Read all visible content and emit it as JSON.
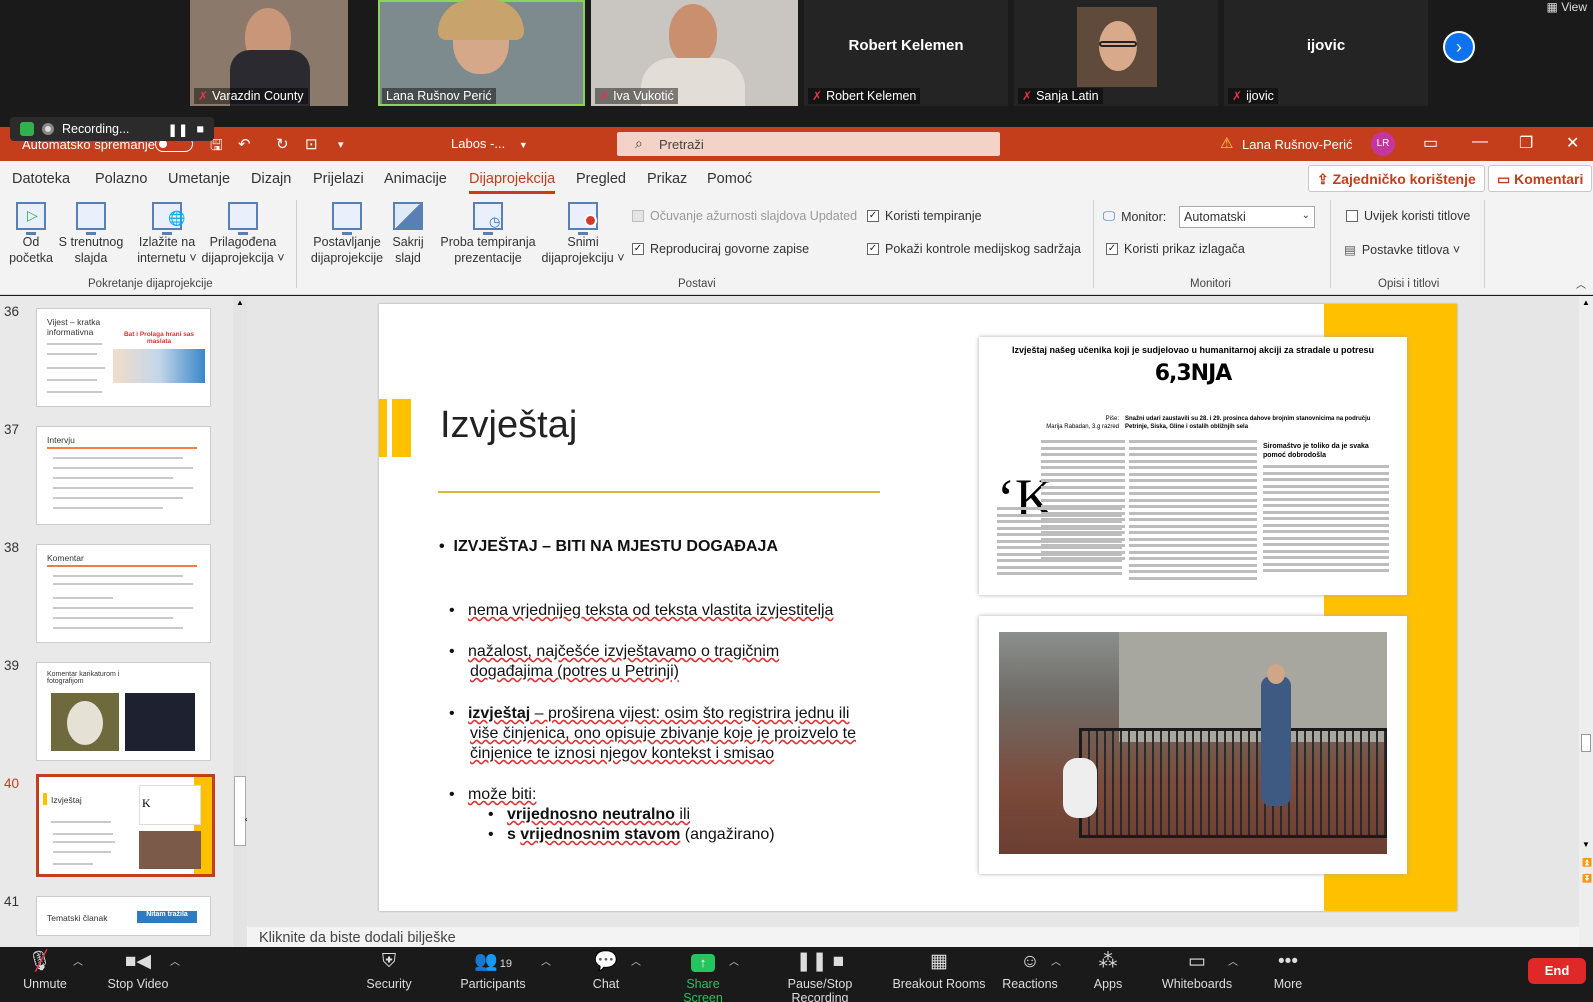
{
  "zoom": {
    "participants": [
      {
        "name": "Varazdin County",
        "muted": true
      },
      {
        "name": "Lana Rušnov Perić",
        "muted": false
      },
      {
        "name": "Iva Vukotić",
        "muted": true
      },
      {
        "name": "Robert Kelemen",
        "muted": true,
        "display_name": "Robert Kelemen"
      },
      {
        "name": "Sanja Latin",
        "muted": true
      },
      {
        "name": "ijovic",
        "muted": true,
        "display_name": "ijovic"
      }
    ],
    "view_label": "View",
    "recording_label": "Recording...",
    "toolbar": {
      "unmute": "Unmute",
      "stop_video": "Stop Video",
      "security": "Security",
      "participants": "Participants",
      "participants_count": "19",
      "chat": "Chat",
      "share_screen": "Share Screen",
      "pause_recording": "Pause/Stop Recording",
      "breakout_rooms": "Breakout Rooms",
      "reactions": "Reactions",
      "apps": "Apps",
      "whiteboards": "Whiteboards",
      "more": "More",
      "end": "End"
    }
  },
  "ppt": {
    "autosave_label": "Automatsko spremanje",
    "doc_name": "Labos -...",
    "search_placeholder": "Pretraži",
    "user_name": "Lana Rušnov-Perić",
    "user_initials": "LR",
    "tabs": [
      "Datoteka",
      "Polazno",
      "Umetanje",
      "Dizajn",
      "Prijelazi",
      "Animacije",
      "Dijaprojekcija",
      "Pregled",
      "Prikaz",
      "Pomoć"
    ],
    "active_tab": "Dijaprojekcija",
    "share_label": "Zajedničko korištenje",
    "comments_label": "Komentari",
    "ribbon": {
      "btn_od_pocetka": [
        "Od",
        "početka"
      ],
      "btn_s_trenutnog": [
        "S trenutnog",
        "slajda"
      ],
      "btn_izlazite": [
        "Izlažite na",
        "internetu ˅"
      ],
      "btn_prilagodena": [
        "Prilagođena",
        "dijaprojekcija ˅"
      ],
      "group_start": "Pokretanje dijaprojekcije",
      "btn_postavljanje": [
        "Postavljanje",
        "dijaprojekcije"
      ],
      "btn_sakrij": [
        "Sakrij",
        "slajd"
      ],
      "btn_proba": [
        "Proba tempiranja",
        "prezentacije"
      ],
      "btn_snimi": [
        "Snimi",
        "dijaprojekciju ˅"
      ],
      "chk_ocuvanje": "Očuvanje ažurnosti slajdova Updated",
      "chk_reproduciraj": "Reproduciraj govorne zapise",
      "chk_tempiranje": "Koristi tempiranje",
      "chk_kontrole": "Pokaži kontrole medijskog sadržaja",
      "group_postavi": "Postavi",
      "monitor_label": "Monitor:",
      "monitor_value": "Automatski",
      "chk_prikaz": "Koristi prikaz izlagača",
      "group_monitori": "Monitori",
      "chk_titlove": "Uvijek koristi titlove",
      "postavke_titlova": "Postavke titlova ˅",
      "group_opisi": "Opisi i titlovi"
    },
    "thumbnails": [
      {
        "num": "36",
        "title": "Vijest – kratka informativna",
        "banner": "Bat i Prolaga hrani sas maslata"
      },
      {
        "num": "37",
        "title": "Intervju"
      },
      {
        "num": "38",
        "title": "Komentar"
      },
      {
        "num": "39",
        "title": "Komentar karikaturom i fotografijom"
      },
      {
        "num": "40",
        "title": "Izvještaj"
      },
      {
        "num": "41",
        "title": "Tematski članak",
        "banner": "Nitam tražila"
      }
    ],
    "slide": {
      "title": "Izvještaj",
      "heading": "IZVJEŠTAJ – BITI NA MJESTU DOGAĐAJA",
      "bullet1": "nema vrjednijeg teksta od teksta vlastita izvjestitelja",
      "bullet2_l1": "nažalost, najčešće izvještavamo o tragičnim",
      "bullet2_l2": "događajima (potres u Petrinji)",
      "bullet3_bold": "izvještaj",
      "bullet3_l1": " – proširena vijest: osim što registrira jednu ili",
      "bullet3_l2": "više činjenica, ono opisuje zbivanje koje je proizvelo te",
      "bullet3_l3": "činjenice te iznosi njegov kontekst i smisao",
      "bullet4": "može biti:",
      "sub1_bold": "vrijednosno neutralno",
      "sub1_rest": " ili",
      "sub2_pre": "s ",
      "sub2_bold": "vrijednosnim stavom",
      "sub2_rest": " (angažirano)",
      "news_header": "Izvještaj našeg učenika koji je sudjelovao u humanitarnoj akciji za stradale u potresu",
      "news_title": "6,3NJA",
      "news_author_label": "Piše:",
      "news_author": "Marija Rabadan, 3.g razred",
      "news_subtitle": "Snažni udari zaustavili su 28. i 29. prosinca dahove brojnim stanovnicima na području Petrinje, Siska, Gline i ostalih obližnjih sela",
      "news_side_heading": "Siromaštvo je toliko da je svaka pomoć dobrodošla"
    },
    "notes_placeholder": "Kliknite da biste dodali bilješke"
  }
}
